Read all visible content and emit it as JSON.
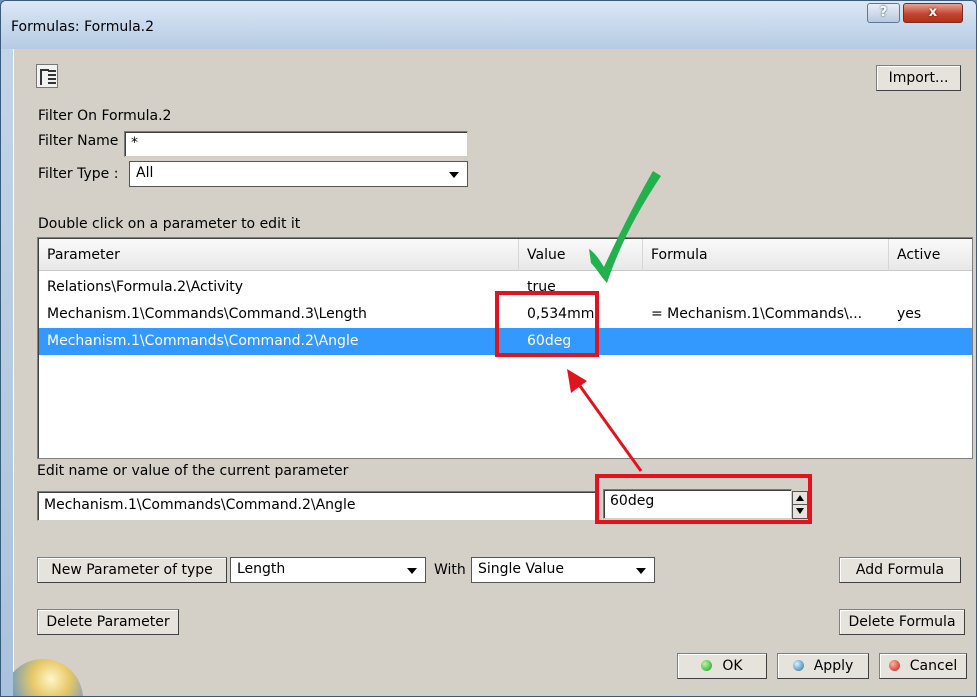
{
  "window": {
    "title": "Formulas: Formula.2",
    "help_glyph": "?",
    "close_glyph": "x"
  },
  "toolbar": {
    "import_label": "Import..."
  },
  "filter": {
    "heading": "Filter On Formula.2",
    "name_label": "Filter Name :",
    "name_value": "*",
    "type_label": "Filter Type :",
    "type_value": "All"
  },
  "table": {
    "caption": "Double click on a parameter to edit it",
    "columns": [
      "Parameter",
      "Value",
      "Formula",
      "Active"
    ],
    "rows": [
      {
        "parameter": "Relations\\Formula.2\\Activity",
        "value": "true",
        "formula": "",
        "active": ""
      },
      {
        "parameter": "Mechanism.1\\Commands\\Command.3\\Length",
        "value": "0,534mm",
        "formula": "= Mechanism.1\\Commands\\...",
        "active": "yes"
      },
      {
        "parameter": "Mechanism.1\\Commands\\Command.2\\Angle",
        "value": "60deg",
        "formula": "",
        "active": "",
        "selected": true
      }
    ]
  },
  "edit": {
    "label": "Edit name or value of the current parameter",
    "name_value": "Mechanism.1\\Commands\\Command.2\\Angle",
    "value_value": "60deg"
  },
  "new_param": {
    "button_label": "New Parameter of type",
    "type_value": "Length",
    "with_label": "With",
    "with_value": "Single Value"
  },
  "actions": {
    "add_formula": "Add Formula",
    "delete_parameter": "Delete Parameter",
    "delete_formula": "Delete Formula",
    "ok": "OK",
    "apply": "Apply",
    "cancel": "Cancel"
  },
  "colors": {
    "selection": "#3399ff",
    "annotation_red": "#e0141e",
    "annotation_green": "#22b14c"
  }
}
